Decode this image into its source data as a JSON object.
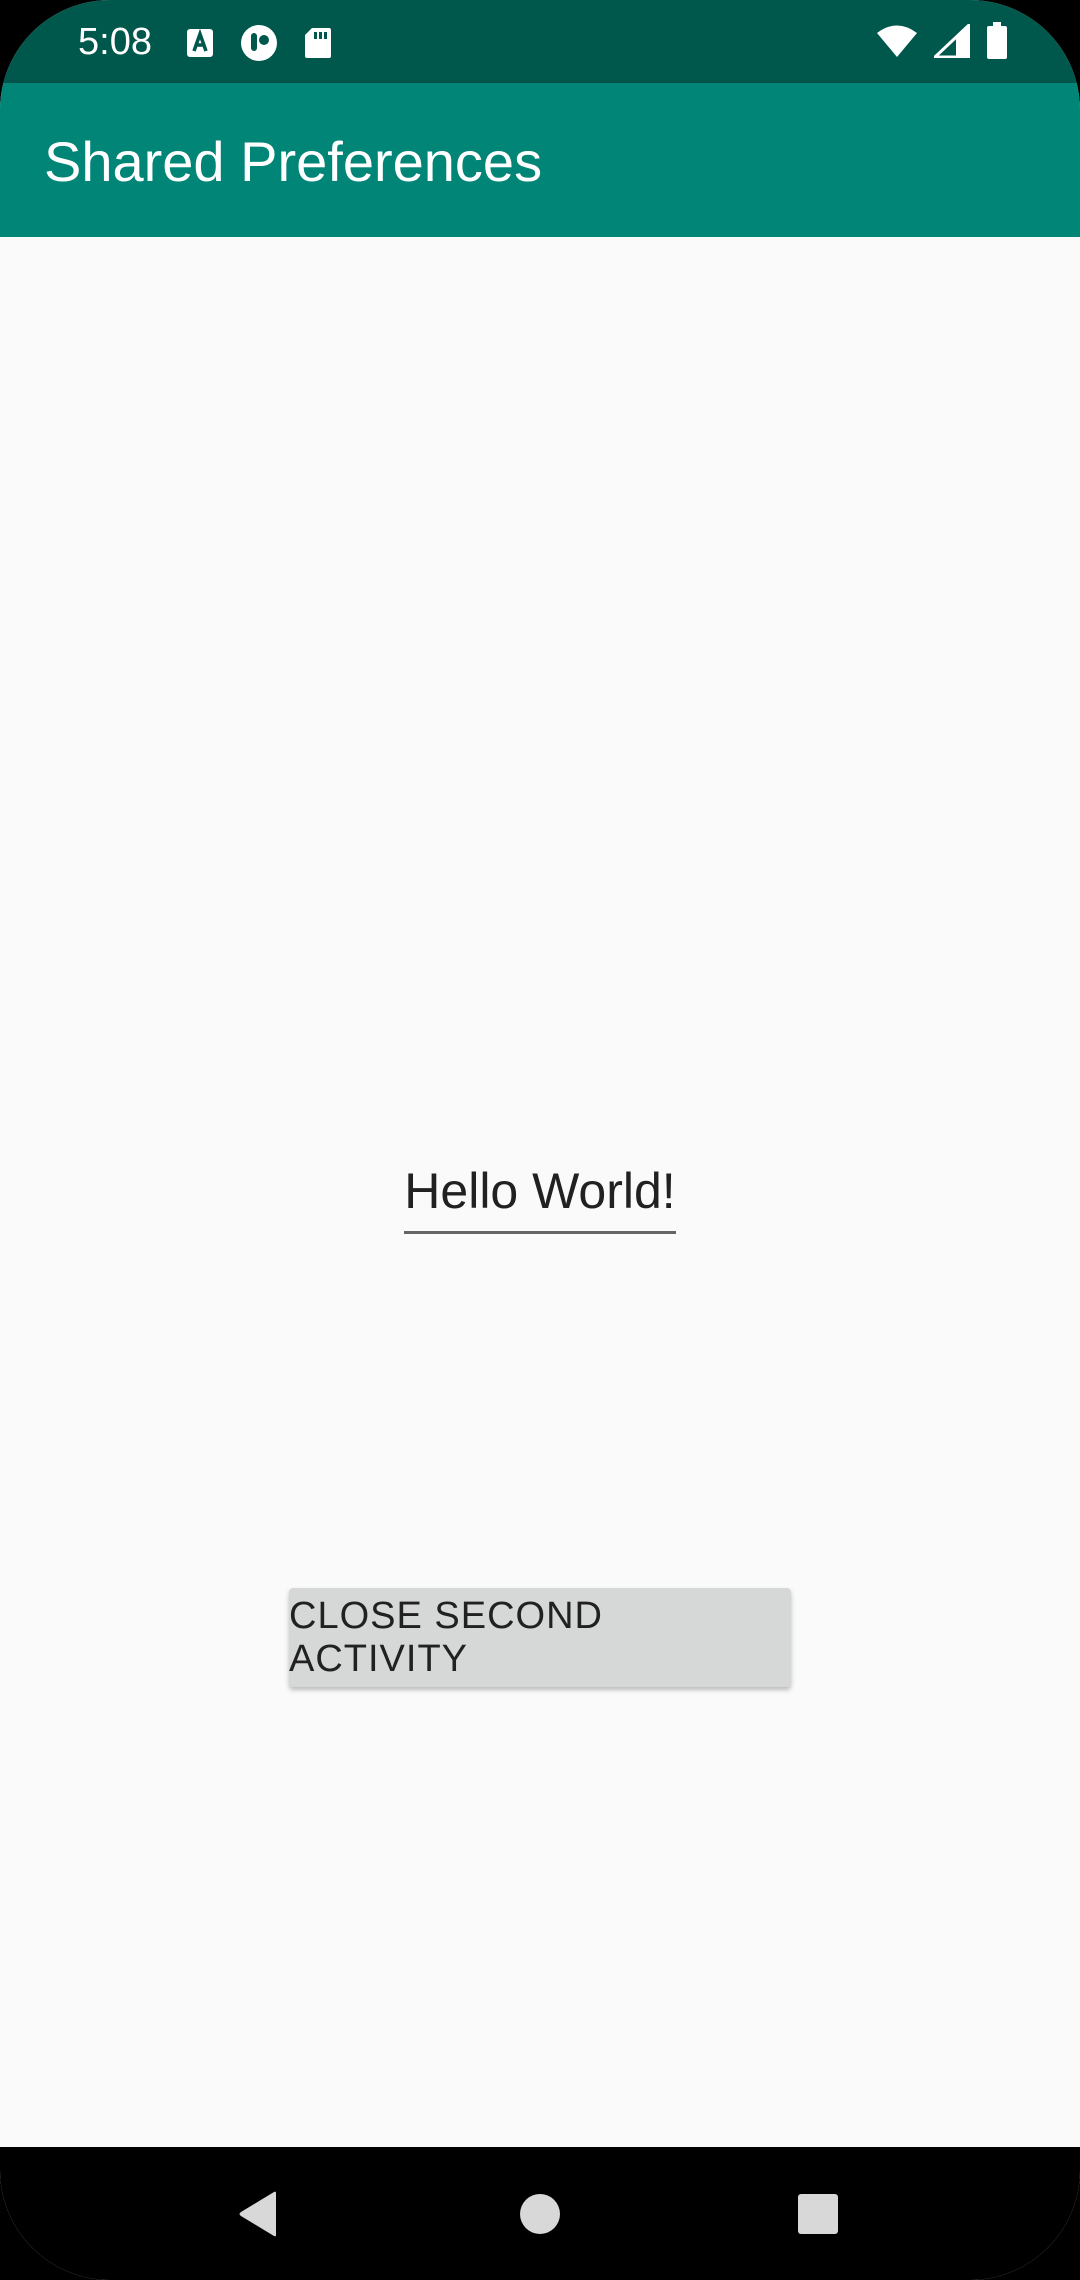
{
  "status_bar": {
    "time": "5:08",
    "left_icons": [
      "font-a-icon",
      "circle-logo-icon",
      "sd-card-icon"
    ],
    "right_icons": [
      "wifi-icon",
      "cell-signal-icon",
      "battery-icon"
    ]
  },
  "app_bar": {
    "title": "Shared Preferences",
    "color": "#008577"
  },
  "main": {
    "edit_text_value": "Hello World!",
    "close_button_label": "CLOSE SECOND ACTIVITY"
  },
  "nav_bar": {
    "buttons": [
      "back-icon",
      "home-icon",
      "recents-icon"
    ]
  },
  "colors": {
    "status_bar": "#00574b",
    "app_bar": "#008577",
    "background": "#fafafa",
    "button": "#d6d7d7"
  }
}
